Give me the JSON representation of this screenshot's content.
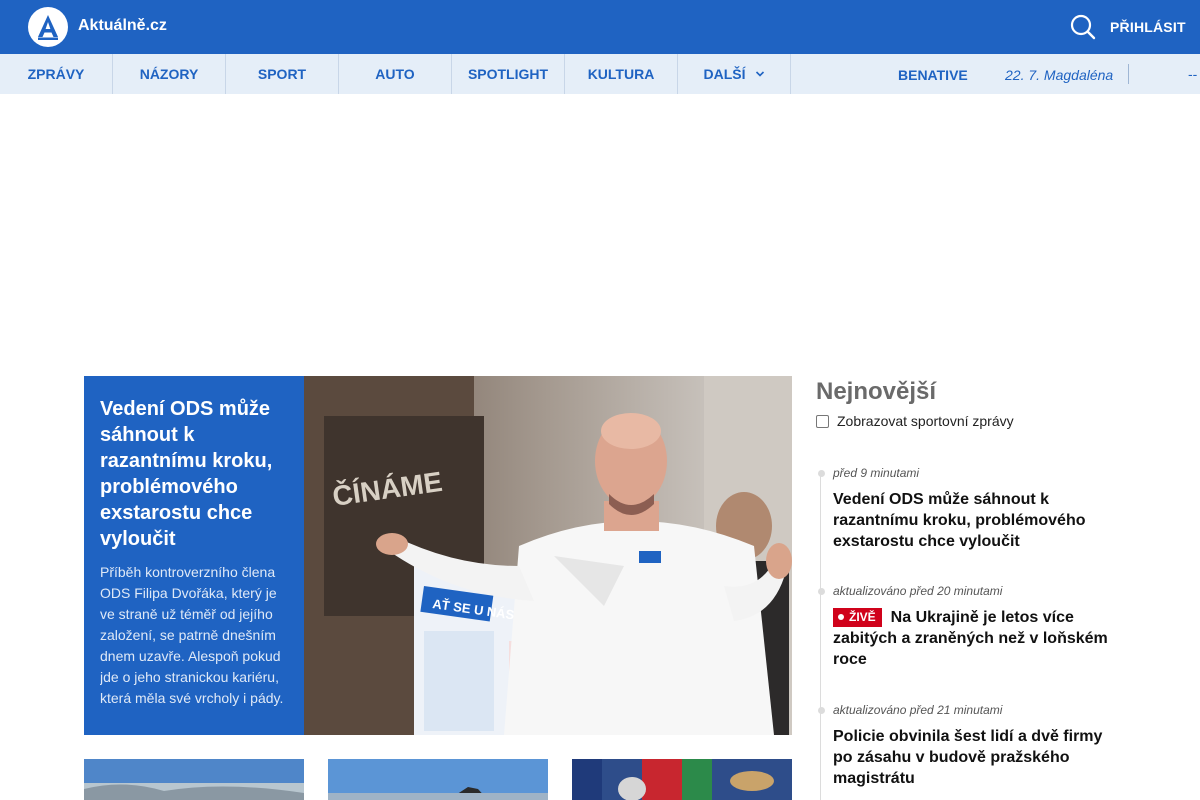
{
  "header": {
    "site_name": "Aktuálně.cz",
    "login_label": "PŘIHLÁSIT",
    "brand_color": "#1f63c2"
  },
  "nav": {
    "items": [
      "ZPRÁVY",
      "NÁZORY",
      "SPORT",
      "AUTO",
      "SPOTLIGHT",
      "KULTURA",
      "DALŠÍ"
    ],
    "benative": "BENATIVE",
    "nameday": "22. 7. Magdaléna",
    "trailing": "--"
  },
  "hero": {
    "title": "Vedení ODS může sáhnout k razantnímu kroku, problémového exstarostu chce vyloučit",
    "perex": "Příběh kontroverzního člena ODS Filipa Dvořáka, který je ve straně už téměř od jejího založení, se patrně dnešním dnem uzavře. Alespoň pokud jde o jeho stranickou kariéru, která měla své vrcholy i pády."
  },
  "latest": {
    "title": "Nejnovější",
    "sport_toggle_label": "Zobrazovat sportovní zprávy",
    "live_label": "ŽIVĚ",
    "items": [
      {
        "time": "před 9 minutami",
        "headline": "Vedení ODS může sáhnout k razantnímu kroku, problémového exstarostu chce vyloučit"
      },
      {
        "time": "aktualizováno před 20 minutami",
        "headline": "Na Ukrajině je letos více zabitých a zraněných než v loňském roce"
      },
      {
        "time": "aktualizováno před 21 minutami",
        "headline": "Policie obvinila šest lidí a dvě firmy po zásahu v budově pražského magistrátu"
      }
    ]
  },
  "colors": {
    "live_red": "#d0021b",
    "nav_bg": "#e5eef8"
  }
}
